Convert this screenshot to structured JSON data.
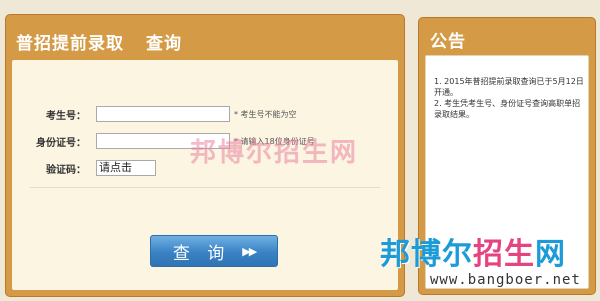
{
  "main_panel": {
    "title": "普招提前录取",
    "title_action": "查询"
  },
  "form": {
    "exam_no": {
      "label": "考生号：",
      "value": "",
      "hint": "* 考生号不能为空"
    },
    "id_no": {
      "label": "身份证号：",
      "value": "",
      "hint": "* 请输入18位身份证号"
    },
    "captcha": {
      "label": "验证码：",
      "value": "请点击"
    },
    "submit_label": "查 询",
    "submit_icon": "double-chevron-right-icon"
  },
  "notice_panel": {
    "title": "公告",
    "items": [
      "1. 2015年普招提前录取查询已于5月12日开通。",
      "2. 考生凭考生号、身份证号查询高职单招录取结果。"
    ]
  },
  "watermark": {
    "center_text": "邦博尔招生网",
    "logo_blue": "邦博尔",
    "logo_pink": "招生",
    "logo_blue2": "网",
    "url": "www.bangboer.net"
  },
  "colors": {
    "panel": "#d49a45",
    "panel_body": "#fbf5e2",
    "button": "#3a82c4",
    "watermark_blue": "#1b9bd8",
    "watermark_pink": "#e4447f"
  }
}
